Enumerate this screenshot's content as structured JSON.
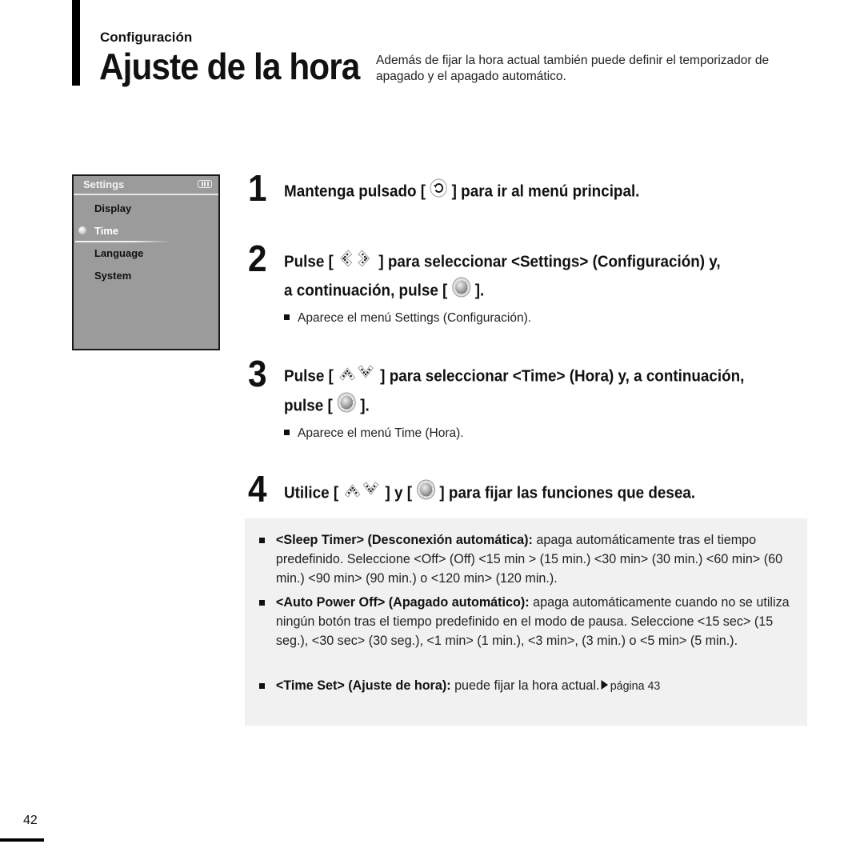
{
  "header": {
    "section": "Configuración",
    "title": "Ajuste de la hora",
    "intro": "Además de fijar la hora actual también puede definir el temporizador de apagado y el apagado automático."
  },
  "device_screen": {
    "title": "Settings",
    "battery_icon": "battery-icon",
    "items": [
      {
        "label": "Display",
        "selected": false
      },
      {
        "label": "Time",
        "selected": true
      },
      {
        "label": "Language",
        "selected": false
      },
      {
        "label": "System",
        "selected": false
      }
    ]
  },
  "steps": [
    {
      "number": "1",
      "parts": [
        "Mantenga pulsado [",
        "] para ir al menú principal."
      ],
      "icons": [
        "back-button-icon"
      ]
    },
    {
      "number": "2",
      "line1": [
        "Pulse [",
        "] para seleccionar <Settings> (Configuración) y,"
      ],
      "line2": [
        "a continuación, pulse [",
        "]."
      ],
      "icons": [
        "left-right-buttons-icon",
        "select-button-icon"
      ],
      "note": "Aparece el menú Settings (Configuración)."
    },
    {
      "number": "3",
      "line1": [
        "Pulse [",
        "] para seleccionar <Time> (Hora) y, a continuación,"
      ],
      "line2": [
        "pulse [",
        "]."
      ],
      "icons": [
        "up-down-buttons-icon",
        "select-button-icon"
      ],
      "note": "Aparece el menú Time (Hora)."
    },
    {
      "number": "4",
      "parts": [
        "Utilice [",
        "] y [",
        "] para fijar las funciones que desea."
      ],
      "icons": [
        "up-down-buttons-icon",
        "select-button-icon"
      ]
    }
  ],
  "info": [
    {
      "term": "<Sleep Timer> (Desconexión automática):",
      "text": " apaga automáticamente tras el tiempo predefinido. Seleccione <Off> (Off) <15 min > (15 min.) <30 min> (30 min.) <60 min> (60 min.) <90 min> (90 min.) o <120 min> (120 min.)."
    },
    {
      "term": "<Auto Power Off> (Apagado automático):",
      "text": " apaga automáticamente cuando no se utiliza ningún botón tras el tiempo predefinido en el modo de pausa. Seleccione <15 sec> (15 seg.), <30 sec> (30 seg.), <1 min> (1 min.), <3 min>, (3 min.) o <5 min> (5 min.)."
    },
    {
      "term": "<Time Set> (Ajuste de hora):",
      "text": " puede fijar la hora actual.",
      "ref": "página 43"
    }
  ],
  "footer": {
    "page_number": "42"
  }
}
